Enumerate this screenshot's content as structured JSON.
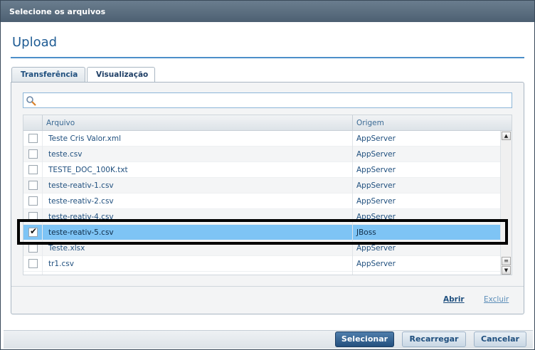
{
  "window": {
    "title": "Selecione os arquivos"
  },
  "header": {
    "title": "Upload"
  },
  "tabs": [
    {
      "label": "Transferência",
      "active": false
    },
    {
      "label": "Visualização",
      "active": true
    }
  ],
  "search": {
    "value": "",
    "placeholder": "",
    "icon": "search-icon"
  },
  "table": {
    "columns": [
      "Arquivo",
      "Origem"
    ],
    "rows": [
      {
        "checked": false,
        "file": "Teste Cris Valor.xml",
        "origin": "AppServer"
      },
      {
        "checked": false,
        "file": "teste.csv",
        "origin": "AppServer"
      },
      {
        "checked": false,
        "file": "TESTE_DOC_100K.txt",
        "origin": "AppServer"
      },
      {
        "checked": false,
        "file": "teste-reativ-1.csv",
        "origin": "AppServer"
      },
      {
        "checked": false,
        "file": "teste-reativ-2.csv",
        "origin": "AppServer"
      },
      {
        "checked": false,
        "file": "teste-reativ-4.csv",
        "origin": "AppServer"
      },
      {
        "checked": true,
        "file": "teste-reativ-5.csv",
        "origin": "JBoss",
        "selected": true
      },
      {
        "checked": false,
        "file": "Teste.xlsx",
        "origin": "AppServer"
      },
      {
        "checked": false,
        "file": "tr1.csv",
        "origin": "AppServer"
      }
    ]
  },
  "actions": {
    "open": "Abrir",
    "delete": "Excluir"
  },
  "buttons": {
    "select": "Selecionar",
    "reload": "Recarregar",
    "cancel": "Cancelar"
  },
  "colors": {
    "accent": "#1f5c94",
    "selected_row": "#7ec4f5",
    "primary_button": "#24507e"
  }
}
